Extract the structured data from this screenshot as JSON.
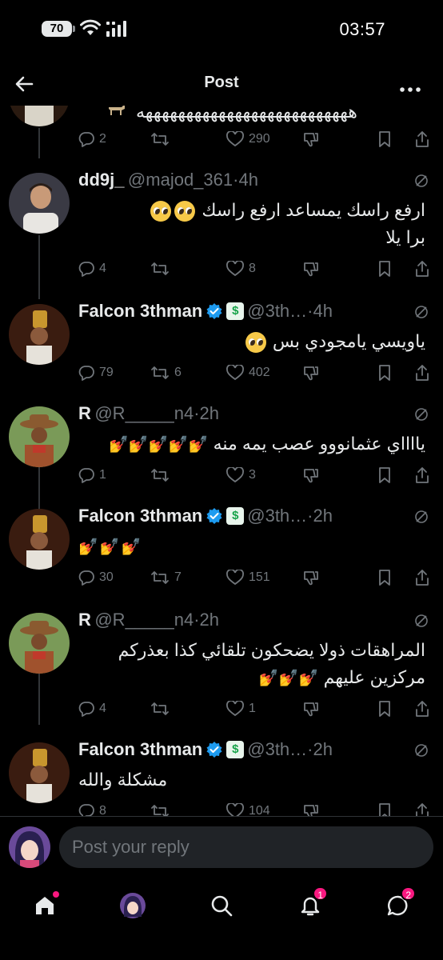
{
  "status": {
    "battery": "70",
    "time": "03:57"
  },
  "header": {
    "title": "Post"
  },
  "top_partial": {
    "text": "ههههههههههههههههههههههههههه",
    "counts": {
      "replies": "2",
      "likes": "290"
    }
  },
  "replies": [
    {
      "name": "dd9j_",
      "handle": "@majod_361",
      "time": "4h",
      "line1": "ارفع راسك يمساعد ارفع راسك",
      "line2": "برا يلا",
      "counts": {
        "replies": "4",
        "reposts": "",
        "likes": "8"
      }
    },
    {
      "name": "Falcon 3thman",
      "handle": "@3th…",
      "time": "4h",
      "line1": "ياويسي يامجودي بس",
      "counts": {
        "replies": "79",
        "reposts": "6",
        "likes": "402"
      }
    },
    {
      "name": "R",
      "handle": "@R_____n4",
      "time": "2h",
      "line1": "يااااي عثمانووو عصب يمه منه",
      "counts": {
        "replies": "1",
        "reposts": "",
        "likes": "3"
      }
    },
    {
      "name": "Falcon 3thman",
      "handle": "@3th…",
      "time": "2h",
      "line1": "",
      "counts": {
        "replies": "30",
        "reposts": "7",
        "likes": "151"
      }
    },
    {
      "name": "R",
      "handle": "@R_____n4",
      "time": "2h",
      "line1": "المراهقات ذولا يضحكون تلقائي كذا بعذركم",
      "line2": "مركزين عليهم",
      "counts": {
        "replies": "4",
        "reposts": "",
        "likes": "1"
      }
    },
    {
      "name": "Falcon 3thman",
      "handle": "@3th…",
      "time": "2h",
      "line1": "مشكلة والله",
      "counts": {
        "replies": "8",
        "reposts": "",
        "likes": "104"
      }
    }
  ],
  "reply_bar": {
    "placeholder": "Post your reply"
  },
  "tabbar": {
    "notifications_badge": "1",
    "messages_badge": "2"
  },
  "icons": {
    "back": "arrow-left-icon",
    "more": "ellipsis-icon",
    "reply": "speech-bubble-icon",
    "repost": "repost-icon",
    "like": "heart-icon",
    "downvote": "thumb-down-icon",
    "bookmark": "bookmark-icon",
    "share": "share-icon",
    "grok": "grok-icon",
    "verified": "verified-badge-icon",
    "affiliate": "dollar-badge-icon"
  },
  "colors": {
    "background": "#000000",
    "text": "#e7e9ea",
    "muted": "#71767b",
    "verified": "#1d9bf0",
    "badge": "#f91880"
  }
}
